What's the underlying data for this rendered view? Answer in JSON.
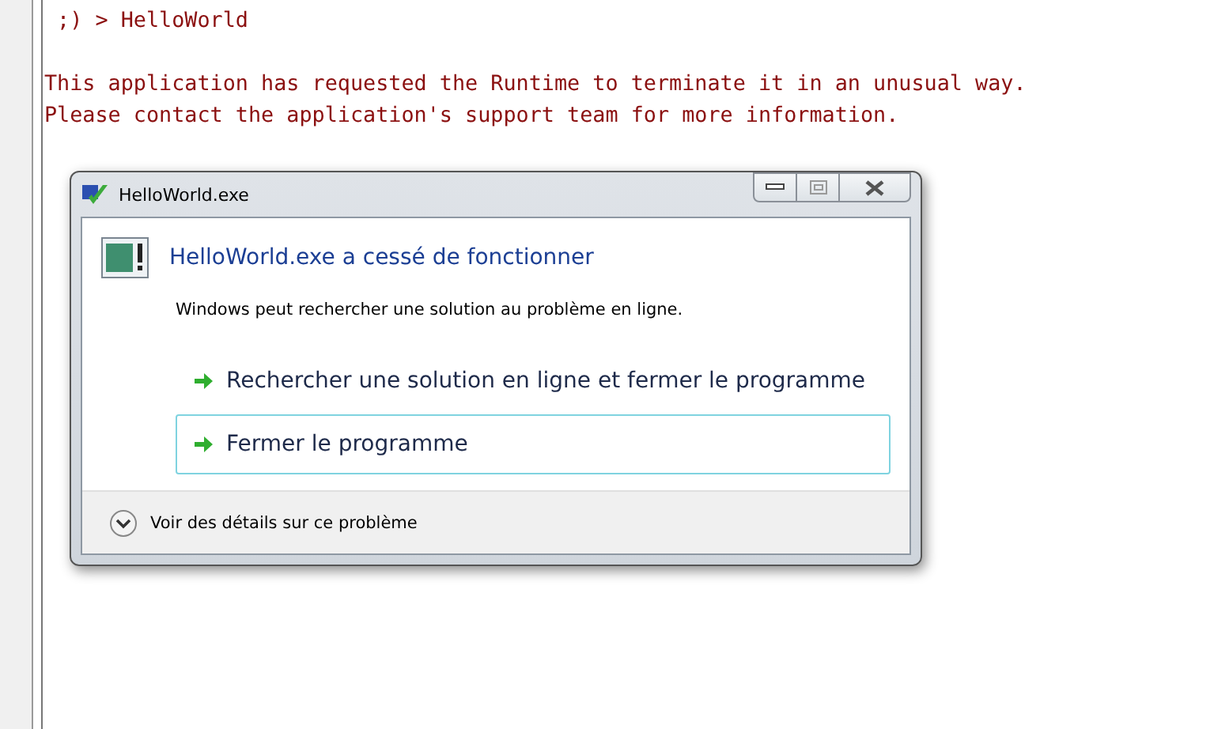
{
  "console": {
    "blocks": [
      [
        " ;) > HelloWorld"
      ],
      [
        "This application has requested the Runtime to terminate it in an unusual way.",
        "Please contact the application's support team for more information."
      ]
    ]
  },
  "dialog": {
    "title": "HelloWorld.exe",
    "heading": "HelloWorld.exe a cessé de fonctionner",
    "message": "Windows peut rechercher une solution au problème en ligne.",
    "options": [
      {
        "label": "Rechercher une solution en ligne et fermer le programme",
        "selected": false
      },
      {
        "label": "Fermer le programme",
        "selected": true
      }
    ],
    "details": {
      "label": "Voir des détails sur ce problème",
      "expanded": false
    }
  }
}
